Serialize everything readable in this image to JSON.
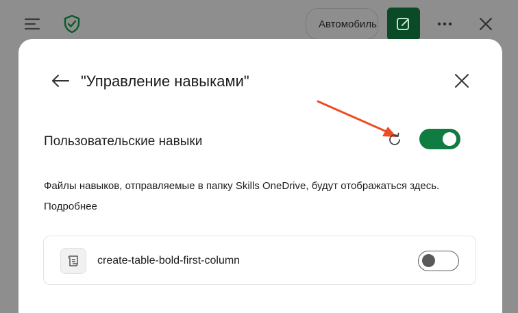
{
  "topbar": {
    "mode_label": "Автомобиль",
    "icons": [
      "menu-icon",
      "shield-check-icon",
      "compose-icon",
      "more-icon",
      "close-icon"
    ],
    "accent": "#0b4a26"
  },
  "modal": {
    "title": "\"Управление навыками\"",
    "custom_skills": {
      "label": "Пользовательские навыки",
      "enabled": true,
      "toggle_color": "#107c41"
    },
    "description": "Файлы навыков, отправляемые в папку Skills OneDrive, будут отображаться здесь.",
    "learn_more": "Подробнее",
    "skills": [
      {
        "name": "create-table-bold-first-column",
        "enabled": false,
        "icon": "scroll-icon"
      }
    ]
  },
  "annotation": {
    "arrow_color": "#f04a23"
  }
}
